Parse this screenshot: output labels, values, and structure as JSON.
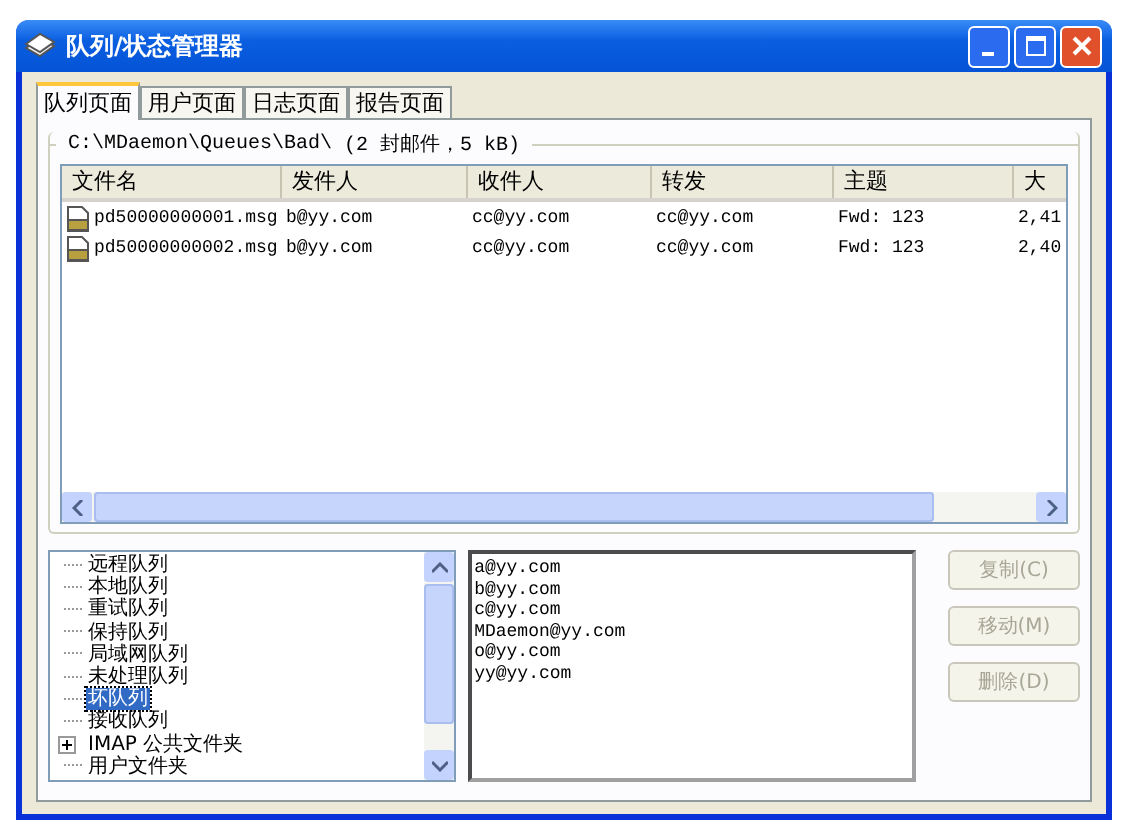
{
  "window": {
    "title": "队列/状态管理器"
  },
  "tabs": [
    {
      "label": "队列页面",
      "selected": true
    },
    {
      "label": "用户页面",
      "selected": false
    },
    {
      "label": "日志页面",
      "selected": false
    },
    {
      "label": "报告页面",
      "selected": false
    }
  ],
  "folder": {
    "path": "C:\\MDaemon\\Queues\\Bad\\",
    "summary": "(2 封邮件，5 kB)"
  },
  "table": {
    "columns": [
      "文件名",
      "发件人",
      "收件人",
      "转发",
      "主题",
      "大"
    ],
    "rows": [
      {
        "cells": [
          "pd50000000001.msg",
          "b@yy.com",
          "cc@yy.com",
          "cc@yy.com",
          "Fwd: 123",
          "2,41"
        ]
      },
      {
        "cells": [
          "pd50000000002.msg",
          "b@yy.com",
          "cc@yy.com",
          "cc@yy.com",
          "Fwd: 123",
          "2,40"
        ]
      }
    ]
  },
  "tree": {
    "items": [
      {
        "label": "远程队列",
        "selected": false,
        "collapsed": false
      },
      {
        "label": "本地队列",
        "selected": false,
        "collapsed": false
      },
      {
        "label": "重试队列",
        "selected": false,
        "collapsed": false
      },
      {
        "label": "保持队列",
        "selected": false,
        "collapsed": false
      },
      {
        "label": "局域网队列",
        "selected": false,
        "collapsed": false
      },
      {
        "label": "未处理队列",
        "selected": false,
        "collapsed": false
      },
      {
        "label": "坏队列",
        "selected": true,
        "collapsed": false
      },
      {
        "label": "接收队列",
        "selected": false,
        "collapsed": false
      },
      {
        "label": "IMAP 公共文件夹",
        "selected": false,
        "collapsed": true
      },
      {
        "label": "用户文件夹",
        "selected": false,
        "collapsed": false
      }
    ]
  },
  "recipients": [
    "a@yy.com",
    "b@yy.com",
    "c@yy.com",
    "MDaemon@yy.com",
    "o@yy.com",
    "yy@yy.com"
  ],
  "buttons": [
    {
      "label": "复制(C)",
      "disabled": true
    },
    {
      "label": "移动(M)",
      "disabled": true
    },
    {
      "label": "删除(D)",
      "disabled": true
    }
  ]
}
